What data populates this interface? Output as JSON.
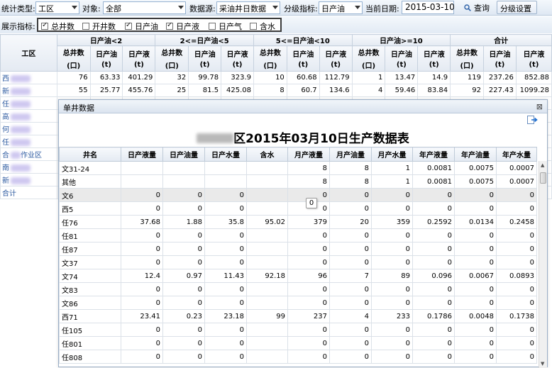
{
  "filter": {
    "stat_type_label": "统计类型:",
    "stat_type_value": "工区",
    "object_label": "对象:",
    "object_value": "全部",
    "source_label": "数据源:",
    "source_value": "采油井日数据",
    "grade_label": "分级指标:",
    "grade_value": "日产油",
    "date_label": "当前日期:",
    "date_value": "2015-03-10",
    "query_button": "查询",
    "grade_settings_button": "分级设置"
  },
  "indicators": {
    "label": "展示指标:",
    "items": [
      {
        "label": "总井数",
        "checked": true
      },
      {
        "label": "开井数",
        "checked": false
      },
      {
        "label": "日产油",
        "checked": true
      },
      {
        "label": "日产液",
        "checked": true
      },
      {
        "label": "日产气",
        "checked": false
      },
      {
        "label": "含水",
        "checked": false
      }
    ]
  },
  "summary": {
    "col_gongqu": "工区",
    "groups": [
      "日产油<2",
      "2<=日产油<5",
      "5<=日产油<10",
      "日产油>=10",
      "合计"
    ],
    "sub_headers": [
      [
        "总井数",
        "(口)"
      ],
      [
        "日产油",
        "(t)"
      ],
      [
        "日产液",
        "(t)"
      ]
    ],
    "rows": [
      {
        "name": "西",
        "cells": [
          "76",
          "63.33",
          "401.29",
          "32",
          "99.78",
          "323.9",
          "10",
          "60.68",
          "112.79",
          "1",
          "13.47",
          "14.9",
          "119",
          "237.26",
          "852.88"
        ]
      },
      {
        "name": "新",
        "cells": [
          "55",
          "25.77",
          "455.76",
          "25",
          "81.5",
          "425.08",
          "8",
          "60.7",
          "134.6",
          "4",
          "59.46",
          "83.84",
          "92",
          "227.43",
          "1099.28"
        ]
      },
      {
        "name": "任",
        "cells": []
      },
      {
        "name": "高",
        "cells": []
      },
      {
        "name": "何",
        "cells": []
      },
      {
        "name": "任",
        "cells": []
      },
      {
        "name": "合",
        "suffix": "作业区",
        "cells": []
      },
      {
        "name": "南",
        "cells": []
      },
      {
        "name": "新",
        "cells": []
      },
      {
        "name": "合计",
        "cells": []
      }
    ]
  },
  "popup": {
    "title": "单井数据",
    "close": "⊠",
    "report_title_suffix": "区2015年03月10日生产数据表",
    "columns": [
      "井名",
      "日产液量",
      "日产油量",
      "日产水量",
      "含水",
      "月产液量",
      "月产油量",
      "月产水量",
      "年产液量",
      "年产油量",
      "年产水量"
    ],
    "rows": [
      [
        "文31-24",
        "",
        "",
        "",
        "",
        "8",
        "8",
        "1",
        "0.0081",
        "0.0075",
        "0.0007"
      ],
      [
        "其他",
        "",
        "",
        "",
        "",
        "8",
        "8",
        "1",
        "0.0081",
        "0.0075",
        "0.0007"
      ],
      [
        "文6",
        "0",
        "0",
        "0",
        "",
        "0",
        "0",
        "0",
        "0",
        "0",
        "0"
      ],
      [
        "西5",
        "0",
        "0",
        "0",
        "",
        "0",
        "0",
        "0",
        "0",
        "0",
        "0"
      ],
      [
        "任76",
        "37.68",
        "1.88",
        "35.8",
        "95.02",
        "379",
        "20",
        "359",
        "0.2592",
        "0.0134",
        "0.2458"
      ],
      [
        "任81",
        "0",
        "0",
        "0",
        "",
        "0",
        "0",
        "0",
        "0",
        "0",
        "0"
      ],
      [
        "任87",
        "0",
        "0",
        "0",
        "",
        "0",
        "0",
        "0",
        "0",
        "0",
        "0"
      ],
      [
        "文37",
        "0",
        "0",
        "0",
        "",
        "0",
        "0",
        "0",
        "0",
        "0",
        "0"
      ],
      [
        "文74",
        "12.4",
        "0.97",
        "11.43",
        "92.18",
        "96",
        "7",
        "89",
        "0.096",
        "0.0067",
        "0.0893"
      ],
      [
        "文83",
        "0",
        "0",
        "0",
        "",
        "0",
        "0",
        "0",
        "0",
        "0",
        "0"
      ],
      [
        "文86",
        "0",
        "0",
        "0",
        "",
        "0",
        "0",
        "0",
        "0",
        "0",
        "0"
      ],
      [
        "西71",
        "23.41",
        "0.23",
        "23.18",
        "99",
        "237",
        "4",
        "233",
        "0.1786",
        "0.0048",
        "0.1738"
      ],
      [
        "任105",
        "0",
        "0",
        "0",
        "",
        "0",
        "0",
        "0",
        "0",
        "0",
        "0"
      ],
      [
        "任801",
        "0",
        "0",
        "0",
        "",
        "0",
        "0",
        "0",
        "0",
        "0",
        "0"
      ],
      [
        "任808",
        "0",
        "0",
        "0",
        "",
        "0",
        "0",
        "0",
        "0",
        "0",
        "0"
      ]
    ],
    "highlight_row": 2,
    "tooltip_value": "0"
  }
}
